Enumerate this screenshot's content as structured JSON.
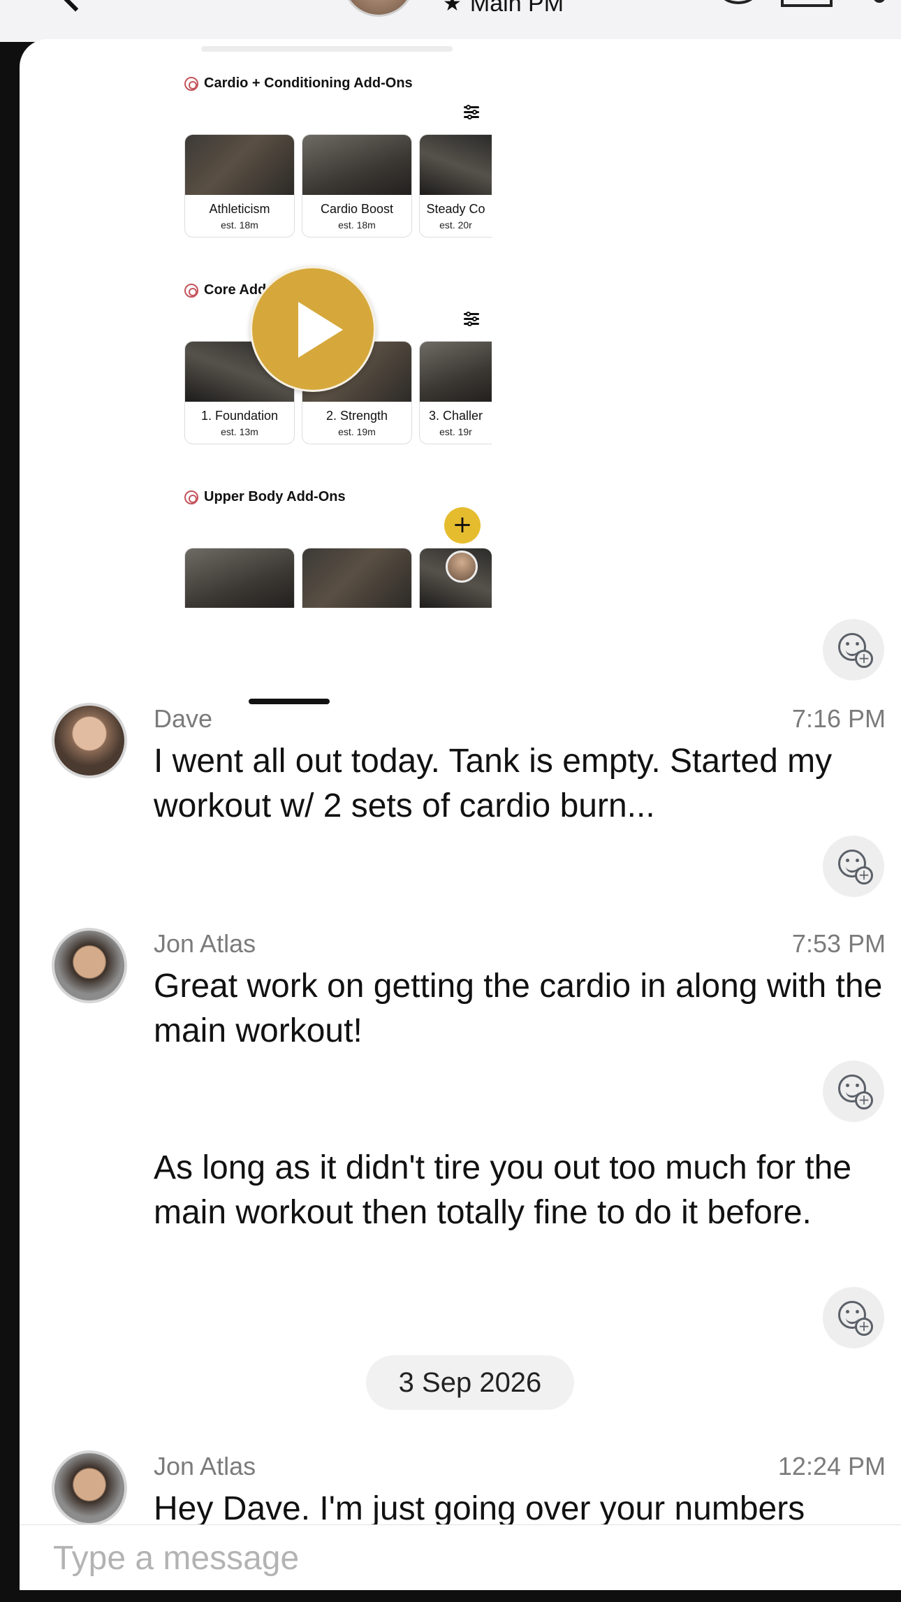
{
  "header": {
    "title": "Main PM",
    "star_icon": "star-icon"
  },
  "shared_image": {
    "sections": [
      {
        "title": "Cardio + Conditioning Add-Ons",
        "cards": [
          {
            "name": "Athleticism",
            "est": "est. 18m"
          },
          {
            "name": "Cardio Boost",
            "est": "est. 18m"
          },
          {
            "name": "Steady Co",
            "est": "est. 20r"
          }
        ]
      },
      {
        "title": "Core Add-Ons",
        "cards": [
          {
            "name": "1. Foundation",
            "est": "est. 13m"
          },
          {
            "name": "2. Strength",
            "est": "est. 19m"
          },
          {
            "name": "3. Challer",
            "est": "est. 19r"
          }
        ]
      },
      {
        "title": "Upper Body Add-Ons",
        "cards": []
      }
    ],
    "plus_label": "+"
  },
  "messages": [
    {
      "sender": "Dave",
      "time": "7:16 PM",
      "text": "I went all out today.  Tank is empty.  Started my workout w/ 2 sets of cardio burn..."
    },
    {
      "sender": "Jon Atlas",
      "time": "7:53 PM",
      "text": "Great work on getting the cardio in along with the main workout!"
    },
    {
      "text": "As long as it didn't tire you out too much for the main workout then totally fine to do it before."
    },
    {
      "sender": "Jon Atlas",
      "time": "12:24 PM",
      "text": "Hey Dave. I'm just going over your numbers"
    }
  ],
  "date_separator": "3 Sep 2026",
  "composer": {
    "placeholder": "Type a message"
  },
  "colors": {
    "accent_gold": "#d6a83b",
    "plus_yellow": "#e6bc2f",
    "name_gray": "#7b7b7b",
    "reaction_bg": "#eeeeee"
  }
}
